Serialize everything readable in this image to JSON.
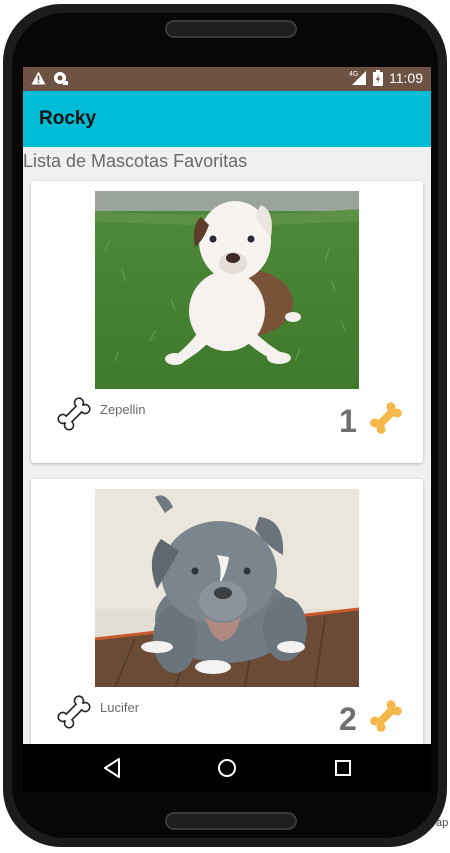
{
  "status_bar": {
    "time": "11:09",
    "network": "4G",
    "icons": [
      "warning-icon",
      "sync-icon",
      "signal-icon",
      "battery-icon"
    ]
  },
  "app_bar": {
    "title": "Rocky"
  },
  "list": {
    "title": "Lista de Mascotas Favoritas",
    "items": [
      {
        "name": "Zepellin",
        "rating": "1",
        "photo": "white-brown-puppy-on-grass"
      },
      {
        "name": "Lucifer",
        "rating": "2",
        "photo": "grey-pitbull-puppy-indoors"
      }
    ]
  },
  "nav_bar": {
    "icons": [
      "back-icon",
      "home-icon",
      "recents-icon"
    ]
  },
  "edge_text": "ap",
  "colors": {
    "status_bar": "#6e5244",
    "app_bar": "#00bcd4",
    "bone_liked": "#f6b84a",
    "background": "#f0f0f0"
  }
}
